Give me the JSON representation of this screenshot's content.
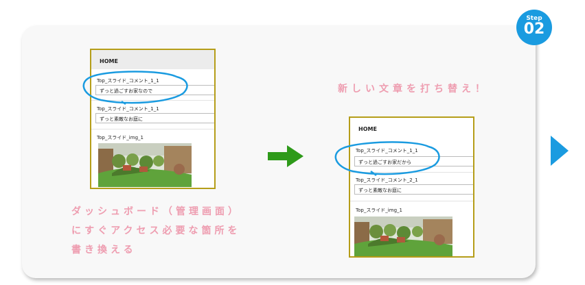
{
  "step": {
    "label": "Step",
    "number": "02"
  },
  "before_panel": {
    "home": "HOME",
    "field1_label": "Top_スライド_コメント_1_1",
    "field1_value": "ずっと過ごすお家なので",
    "field2_label": "Top_スライド_コメント_1_1",
    "field2_value": "ずっと素敵なお庭に",
    "image_label": "Top_スライド_img_1"
  },
  "after_panel": {
    "home": "HOME",
    "field1_label": "Top_スライド_コメント_1_1",
    "field1_value": "ずっと過ごすお家だから",
    "field2_label": "Top_スライド_コメント_2_1",
    "field2_value": "ずっと素敵なお庭に",
    "image_label": "Top_スライド_img_1"
  },
  "caption_right": "新しい文章を打ち替え！",
  "caption_left": [
    "ダッシュボード（管理画面）",
    "にすぐアクセス必要な箇所を",
    "書き換える"
  ],
  "colors": {
    "accent_blue": "#1a9be0",
    "arrow_green": "#2e9a1a",
    "frame_gold": "#b59d18",
    "caption_pink": "#ee9db0"
  },
  "icons": {
    "next": "arrow-right-icon",
    "proceed": "triangle-right-icon"
  }
}
